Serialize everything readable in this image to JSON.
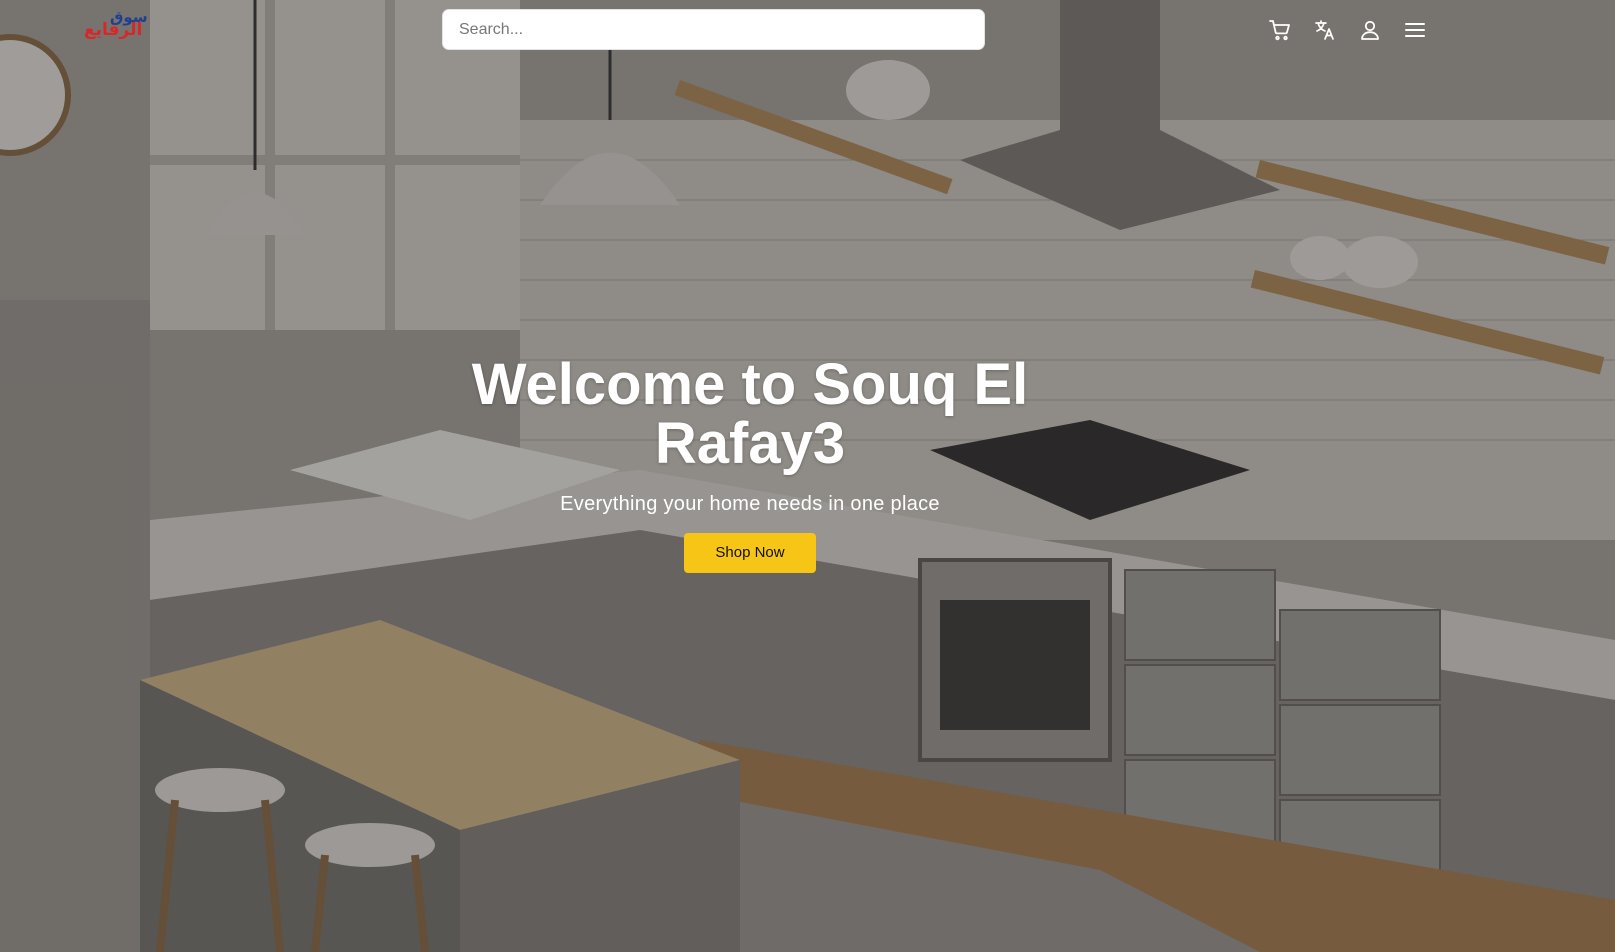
{
  "brand": {
    "logo_text": "الرفايع",
    "logo_mark": "سوق",
    "colors": {
      "logo_red": "#d62828",
      "logo_blue": "#1f3f8f"
    }
  },
  "search": {
    "placeholder": "Search...",
    "value": ""
  },
  "nav": {
    "icons": [
      "cart-icon",
      "translate-icon",
      "user-icon",
      "menu-icon"
    ]
  },
  "hero": {
    "title": "Welcome to Souq El Rafay3",
    "subtitle": "Everything your home needs in one place",
    "cta_label": "Shop Now",
    "colors": {
      "cta_background": "#f6c516",
      "text": "#ffffff"
    }
  }
}
